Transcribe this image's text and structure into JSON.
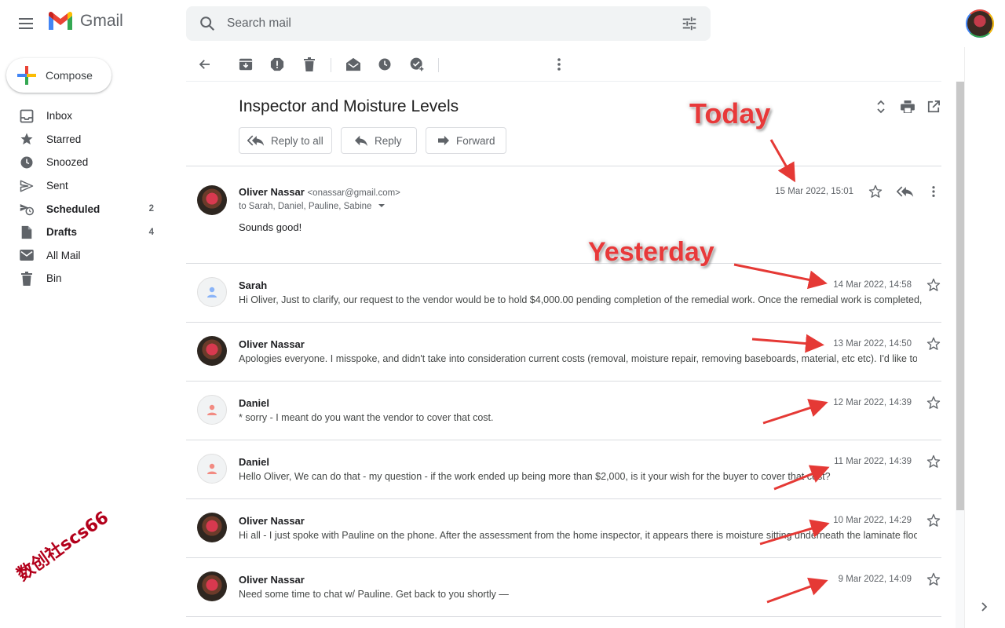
{
  "app": {
    "name": "Gmail"
  },
  "search": {
    "placeholder": "Search mail"
  },
  "compose": {
    "label": "Compose"
  },
  "sidebar": {
    "items": [
      {
        "label": "Inbox",
        "icon": "inbox-icon",
        "count": "",
        "bold": false
      },
      {
        "label": "Starred",
        "icon": "star-icon",
        "count": "",
        "bold": false
      },
      {
        "label": "Snoozed",
        "icon": "clock-icon",
        "count": "",
        "bold": false
      },
      {
        "label": "Sent",
        "icon": "send-icon",
        "count": "",
        "bold": false
      },
      {
        "label": "Scheduled",
        "icon": "scheduled-send-icon",
        "count": "2",
        "bold": true
      },
      {
        "label": "Drafts",
        "icon": "draft-icon",
        "count": "4",
        "bold": true
      },
      {
        "label": "All Mail",
        "icon": "mail-icon",
        "count": "",
        "bold": false
      },
      {
        "label": "Bin",
        "icon": "trash-icon",
        "count": "",
        "bold": false
      }
    ]
  },
  "watermark": "数创社scs66",
  "thread": {
    "subject": "Inspector and Moisture Levels",
    "actions": {
      "reply_all": "Reply to all",
      "reply": "Reply",
      "forward": "Forward"
    },
    "messages": [
      {
        "sender": "Oliver Nassar",
        "email": "<onassar@gmail.com>",
        "to": "to Sarah, Daniel, Pauline, Sabine",
        "body": "Sounds good!",
        "date": "15 Mar 2022, 15:01",
        "avatar": "photo",
        "expanded": true
      },
      {
        "sender": "Sarah",
        "snippet": "Hi Oliver, Just to clarify, our request to the vendor would be to hold $4,000.00 pending completion of the remedial work. Once the remedial work is completed, t",
        "date": "14 Mar 2022, 14:58",
        "avatar": "generic-blue"
      },
      {
        "sender": "Oliver Nassar",
        "snippet": "Apologies everyone. I misspoke, and didn't take into consideration current costs (removal, moisture repair, removing baseboards, material, etc etc). I'd like to",
        "date": "13 Mar 2022, 14:50",
        "avatar": "photo"
      },
      {
        "sender": "Daniel",
        "snippet": "* sorry - I meant do you want the vendor to cover that cost.",
        "date": "12 Mar 2022, 14:39",
        "avatar": "generic-red"
      },
      {
        "sender": "Daniel",
        "snippet": "Hello Oliver, We can do that - my question - if the work ended up being more than $2,000, is it your wish for the buyer to cover that cost?",
        "date": "11 Mar 2022, 14:39",
        "avatar": "generic-red"
      },
      {
        "sender": "Oliver Nassar",
        "snippet": "Hi all - I just spoke with Pauline on the phone. After the assessment from the home inspector, it appears there is moisture sitting underneath the laminate floo",
        "date": "10 Mar 2022, 14:29",
        "avatar": "photo"
      },
      {
        "sender": "Oliver Nassar",
        "snippet": "Need some time to chat w/ Pauline. Get back to you shortly —",
        "date": "9 Mar 2022, 14:09",
        "avatar": "photo"
      }
    ]
  },
  "annotations": {
    "today": "Today",
    "yesterday": "Yesterday"
  },
  "colors": {
    "annotation": "#e8393a",
    "watermark": "#b3001b"
  }
}
